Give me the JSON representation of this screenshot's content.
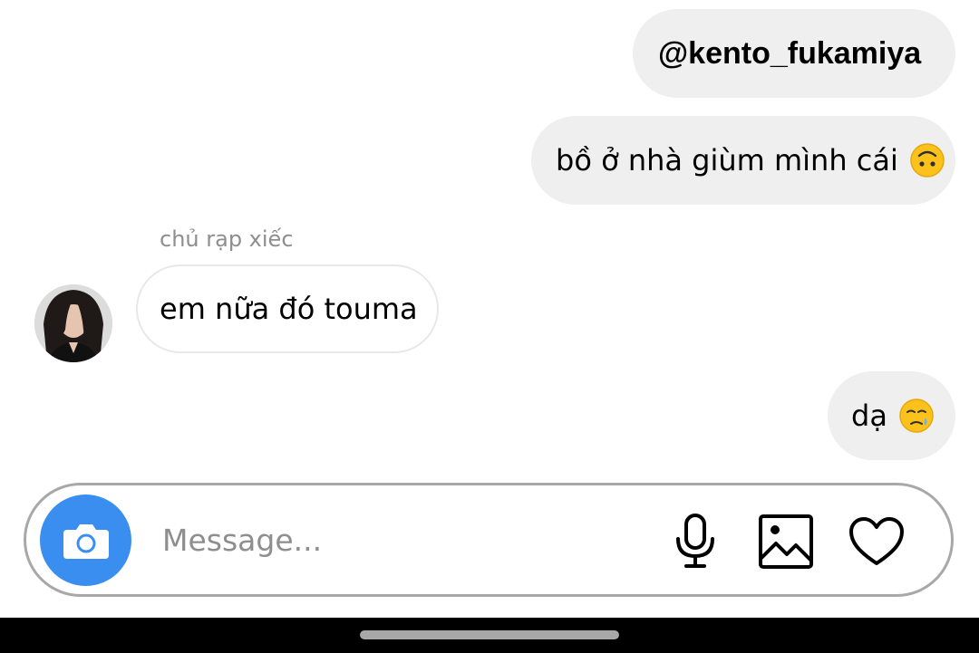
{
  "messages": {
    "mention": "@kento_fukamiya",
    "outgoing_1": "bồ ở nhà giùm mình cái",
    "outgoing_1_emoji": "upside-down-face",
    "sender_name": "chủ rạp xiếc",
    "incoming_1": "em nữa đó touma",
    "outgoing_2": "dạ",
    "outgoing_2_emoji": "face-holding-back-tears"
  },
  "composer": {
    "placeholder": "Message...",
    "camera_icon": "camera-icon",
    "mic_icon": "microphone-icon",
    "gallery_icon": "image-icon",
    "like_icon": "heart-icon"
  },
  "colors": {
    "outgoing_bubble": "#efefef",
    "camera_button": "#3a8ef0",
    "secondary_text": "#8e8e8e"
  }
}
